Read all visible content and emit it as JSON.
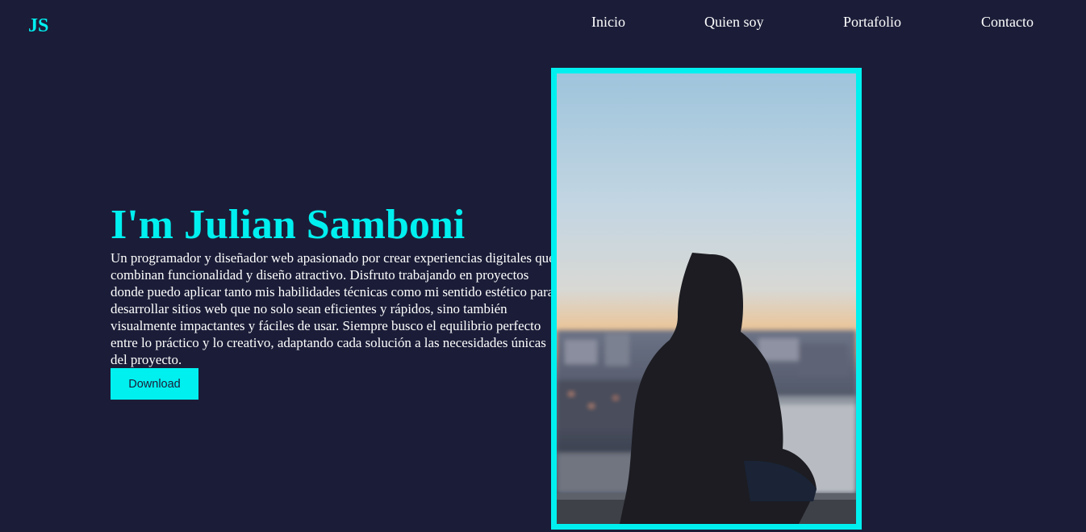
{
  "header": {
    "logo": "JS",
    "nav": [
      "Inicio",
      "Quien soy",
      "Portafolio",
      "Contacto"
    ]
  },
  "hero": {
    "title": "I'm Julian Samboni",
    "description": "Un programador y diseñador web apasionado por crear experiencias digitales que combinan funcionalidad y diseño atractivo. Disfruto trabajando en proyectos donde puedo aplicar tanto mis habilidades técnicas como mi sentido estético para desarrollar sitios web que no solo sean eficientes y rápidos, sino también visualmente impactantes y fáciles de usar. Siempre busco el equilibrio perfecto entre lo práctico y lo creativo, adaptando cada solución a las necesidades únicas del proyecto.",
    "button_label": "Download"
  },
  "colors": {
    "background": "#1b1d38",
    "accent": "#00f0f0",
    "text": "#ffffff"
  },
  "photo": {
    "subject": "person-in-hoodie-sunset-icon"
  }
}
